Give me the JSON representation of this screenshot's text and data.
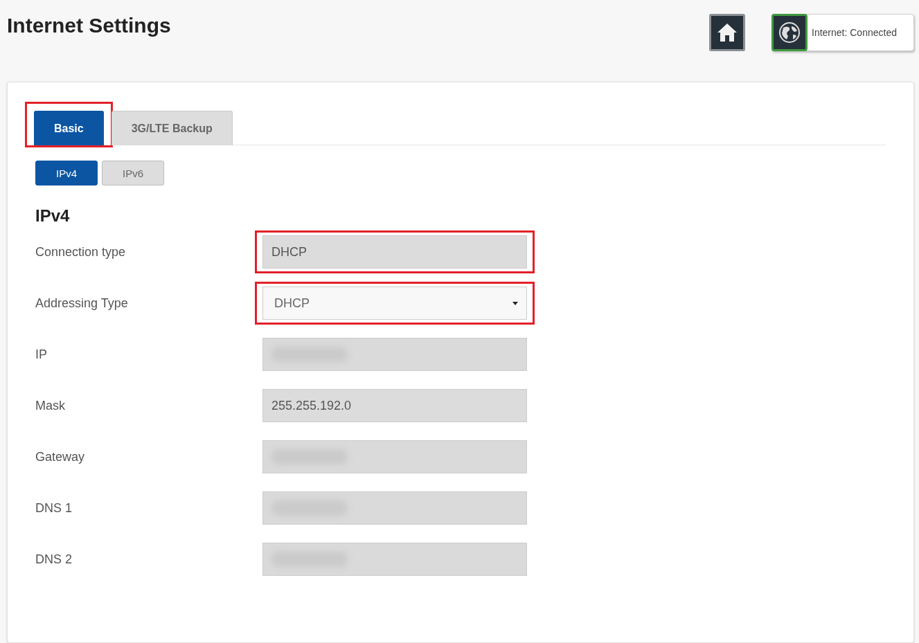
{
  "header": {
    "title": "Internet Settings",
    "status": {
      "label": "Internet: Connected",
      "connected": true
    }
  },
  "tabs": [
    {
      "label": "Basic",
      "selected": true,
      "highlighted": true
    },
    {
      "label": "3G/LTE Backup",
      "selected": false,
      "highlighted": false
    }
  ],
  "subtabs": [
    {
      "label": "IPv4",
      "selected": true
    },
    {
      "label": "IPv6",
      "selected": false
    }
  ],
  "section_title": "IPv4",
  "fields": [
    {
      "label": "Connection type",
      "kind": "readonly",
      "value": "DHCP",
      "highlighted": true
    },
    {
      "label": "Addressing Type",
      "kind": "select",
      "value": "DHCP",
      "highlighted": true
    },
    {
      "label": "IP",
      "kind": "blurred",
      "highlighted": false
    },
    {
      "label": "Mask",
      "kind": "readonly",
      "value": "255.255.192.0",
      "highlighted": false
    },
    {
      "label": "Gateway",
      "kind": "blurred",
      "highlighted": false
    },
    {
      "label": "DNS 1",
      "kind": "blurred",
      "highlighted": false
    },
    {
      "label": "DNS 2",
      "kind": "blurred",
      "highlighted": false
    }
  ]
}
